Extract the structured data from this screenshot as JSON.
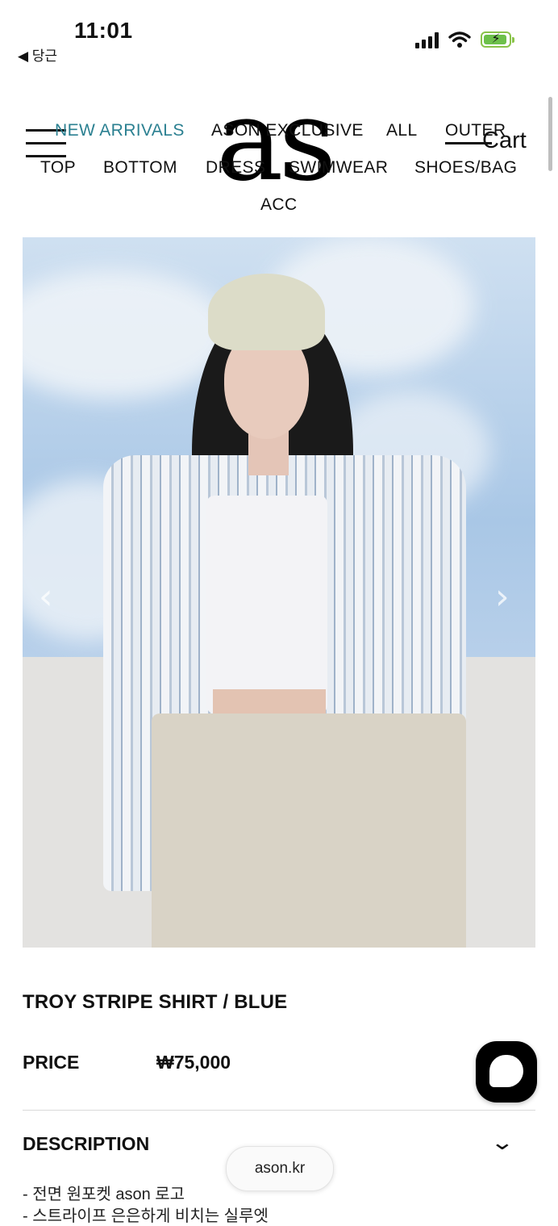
{
  "status_bar": {
    "time": "11:01",
    "back_label": "◀ 당근"
  },
  "header": {
    "logo": "as",
    "nav": [
      "NEW ARRIVALS",
      "ASON EXCLUSIVE",
      "ALL",
      "OUTER",
      "TOP",
      "BOTTOM",
      "DRESS",
      "SWIMWEAR",
      "SHOES/BAG",
      "ACC"
    ],
    "cart_label": "Cart"
  },
  "carousel": {
    "prev": "‹",
    "next": "›"
  },
  "product": {
    "title": "TROY STRIPE SHIRT / BLUE",
    "price_label": "PRICE",
    "price": "₩75,000",
    "description_label": "DESCRIPTION",
    "description_lines": [
      "- 전면 원포켓 ason 로고",
      "- 스트라이프 은은하게 비치는 실루엣"
    ]
  },
  "browser": {
    "url": "ason.kr"
  },
  "colors": {
    "accent": "#2b8091",
    "text": "#111111"
  }
}
